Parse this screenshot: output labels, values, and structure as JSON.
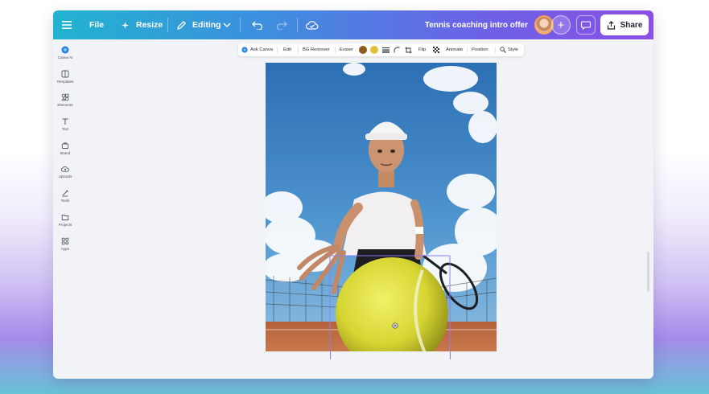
{
  "topbar": {
    "menu_icon": "hamburger-icon",
    "file_label": "File",
    "resize_label": "Resize",
    "editing_label": "Editing",
    "document_title": "Tennis coaching intro offer",
    "share_label": "Share",
    "plus_label": "+"
  },
  "sidebar": {
    "items": [
      {
        "label": "Canva AI",
        "icon": "canva-ai-icon"
      },
      {
        "label": "Templates",
        "icon": "templates-icon"
      },
      {
        "label": "Elements",
        "icon": "elements-icon"
      },
      {
        "label": "Text",
        "icon": "text-icon"
      },
      {
        "label": "Brand",
        "icon": "brand-icon"
      },
      {
        "label": "Uploads",
        "icon": "uploads-icon"
      },
      {
        "label": "Tools",
        "icon": "tools-icon"
      },
      {
        "label": "Projects",
        "icon": "projects-icon"
      },
      {
        "label": "Apps",
        "icon": "apps-icon"
      }
    ]
  },
  "context_toolbar": {
    "ask_canva": "Ask Canva",
    "edit": "Edit",
    "bg_remover": "BG Remover",
    "eraser": "Eraser",
    "flip": "Flip",
    "animate": "Animate",
    "position": "Position",
    "style": "Style",
    "swatches": [
      "#8a5a1e",
      "#e2c13a"
    ]
  },
  "colors": {
    "topbar_start": "#21b3cf",
    "topbar_end": "#8a4fe6",
    "selection": "#8b7cf0",
    "canvas_bg": "#f2f3f7"
  }
}
